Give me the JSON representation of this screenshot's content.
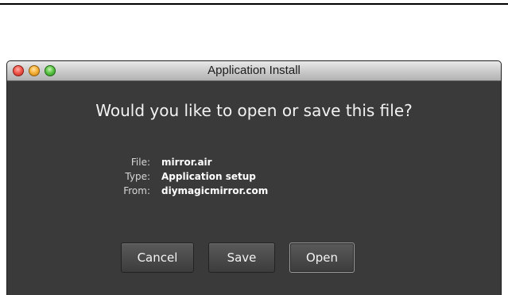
{
  "window": {
    "title": "Application Install"
  },
  "dialog": {
    "question": "Would you like to open or save this file?",
    "details": [
      {
        "label": "File:",
        "value": "mirror.air"
      },
      {
        "label": "Type:",
        "value": "Application setup"
      },
      {
        "label": "From:",
        "value": "diymagicmirror.com"
      }
    ]
  },
  "buttons": {
    "cancel": "Cancel",
    "save": "Save",
    "open": "Open"
  },
  "colors": {
    "dialog_background": "#3a3a3a",
    "close_button": "#f25a4e",
    "minimize_button": "#f7b33a",
    "maximize_button": "#5ec74a"
  }
}
